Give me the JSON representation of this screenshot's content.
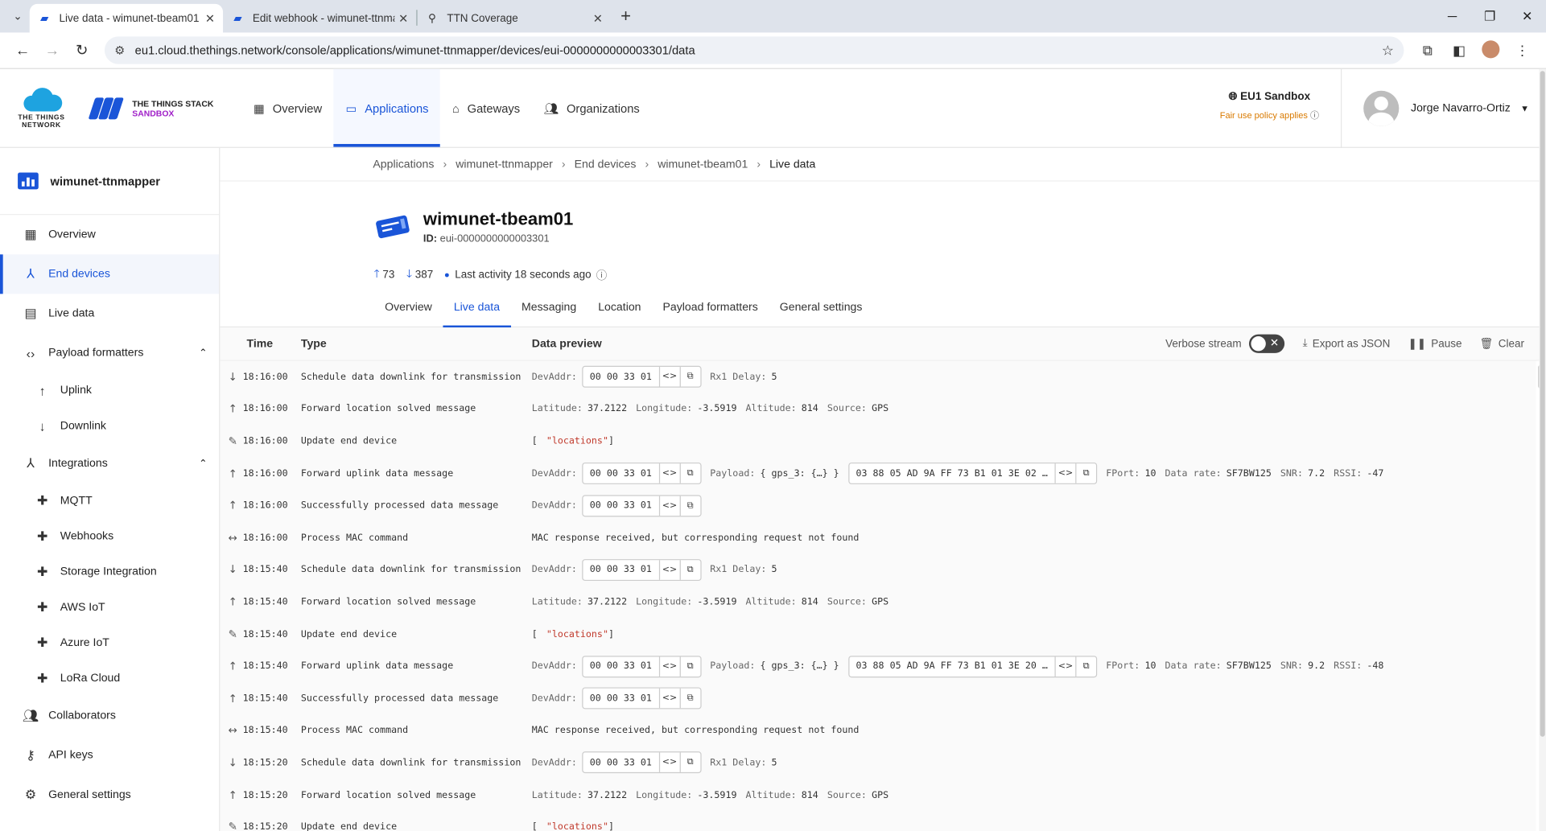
{
  "browser": {
    "tabs": [
      {
        "label": "Live data - wimunet-tbeam01 -",
        "active": true,
        "icon": "ttn-icon"
      },
      {
        "label": "Edit webhook - wimunet-ttnma",
        "active": false,
        "icon": "ttn-icon"
      },
      {
        "label": "TTN Coverage",
        "active": false,
        "icon": "map-pin-icon"
      }
    ],
    "url": "eu1.cloud.thethings.network/console/applications/wimunet-ttnmapper/devices/eui-0000000000003301/data"
  },
  "header": {
    "logo_text": "THE THINGS NETWORK",
    "stack_line1": "THE THINGS STACK",
    "stack_line2": "SANDBOX",
    "nav": [
      {
        "label": "Overview",
        "icon": "dashboard-icon",
        "active": false
      },
      {
        "label": "Applications",
        "icon": "application-icon",
        "active": true
      },
      {
        "label": "Gateways",
        "icon": "gateway-icon",
        "active": false
      },
      {
        "label": "Organizations",
        "icon": "organizations-icon",
        "active": false
      }
    ],
    "region": "EU1 Sandbox",
    "fair_use": "Fair use policy applies",
    "user": "Jorge Navarro-Ortiz"
  },
  "sidebar": {
    "app_name": "wimunet-ttnmapper",
    "items": [
      {
        "label": "Overview",
        "icon": "dashboard-icon"
      },
      {
        "label": "End devices",
        "icon": "devices-icon",
        "active": true
      },
      {
        "label": "Live data",
        "icon": "live-data-icon"
      },
      {
        "label": "Payload formatters",
        "icon": "code-icon"
      },
      {
        "label": "Uplink",
        "icon": "arrow-up-icon"
      },
      {
        "label": "Downlink",
        "icon": "arrow-down-icon"
      },
      {
        "label": "Integrations",
        "icon": "integrations-icon"
      },
      {
        "label": "MQTT",
        "icon": "puzzle-icon"
      },
      {
        "label": "Webhooks",
        "icon": "puzzle-icon"
      },
      {
        "label": "Storage Integration",
        "icon": "puzzle-icon"
      },
      {
        "label": "AWS IoT",
        "icon": "puzzle-icon"
      },
      {
        "label": "Azure IoT",
        "icon": "puzzle-icon"
      },
      {
        "label": "LoRa Cloud",
        "icon": "puzzle-icon"
      },
      {
        "label": "Collaborators",
        "icon": "people-icon"
      },
      {
        "label": "API keys",
        "icon": "key-icon"
      },
      {
        "label": "General settings",
        "icon": "gear-icon"
      }
    ]
  },
  "breadcrumb": [
    "Applications",
    "wimunet-ttnmapper",
    "End devices",
    "wimunet-tbeam01",
    "Live data"
  ],
  "device": {
    "name": "wimunet-tbeam01",
    "id_label": "ID:",
    "id": "eui-0000000000003301",
    "uplinks": "73",
    "downlinks": "387",
    "last_activity": "Last activity 18 seconds ago"
  },
  "device_tabs": [
    "Overview",
    "Live data",
    "Messaging",
    "Location",
    "Payload formatters",
    "General settings"
  ],
  "live": {
    "col_time": "Time",
    "col_type": "Type",
    "col_preview": "Data preview",
    "verbose": "Verbose stream",
    "export": "Export as JSON",
    "pause": "Pause",
    "clear": "Clear",
    "rows": [
      {
        "icon": "arrow-down-icon",
        "time": "18:16:00",
        "type": "Schedule data downlink for transmission",
        "kind": "downlink",
        "devaddr": "00 00 33 01",
        "rx1": "5"
      },
      {
        "icon": "arrow-up-icon",
        "time": "18:16:00",
        "type": "Forward location solved message",
        "kind": "location",
        "lat": "37.2122",
        "lon": "-3.5919",
        "alt": "814",
        "src": "GPS"
      },
      {
        "icon": "pencil-icon",
        "time": "18:16:00",
        "type": "Update end device",
        "kind": "update",
        "locations": "\"locations\""
      },
      {
        "icon": "arrow-up-icon",
        "time": "18:16:00",
        "type": "Forward uplink data message",
        "kind": "uplink",
        "devaddr": "00 00 33 01",
        "payload": "{ gps_3: {…} }",
        "bytes": "03 88 05 AD 9A FF 73 B1 01 3E 02 …",
        "fport": "10",
        "rate": "SF7BW125",
        "snr": "7.2",
        "rssi": "-47"
      },
      {
        "icon": "arrow-up-icon",
        "time": "18:16:00",
        "type": "Successfully processed data message",
        "kind": "processed",
        "devaddr": "00 00 33 01"
      },
      {
        "icon": "mac-icon",
        "time": "18:16:00",
        "type": "Process MAC command",
        "kind": "mac",
        "text": "MAC response received, but corresponding request not found"
      },
      {
        "icon": "arrow-down-icon",
        "time": "18:15:40",
        "type": "Schedule data downlink for transmission",
        "kind": "downlink",
        "devaddr": "00 00 33 01",
        "rx1": "5"
      },
      {
        "icon": "arrow-up-icon",
        "time": "18:15:40",
        "type": "Forward location solved message",
        "kind": "location",
        "lat": "37.2122",
        "lon": "-3.5919",
        "alt": "814",
        "src": "GPS"
      },
      {
        "icon": "pencil-icon",
        "time": "18:15:40",
        "type": "Update end device",
        "kind": "update",
        "locations": "\"locations\""
      },
      {
        "icon": "arrow-up-icon",
        "time": "18:15:40",
        "type": "Forward uplink data message",
        "kind": "uplink",
        "devaddr": "00 00 33 01",
        "payload": "{ gps_3: {…} }",
        "bytes": "03 88 05 AD 9A FF 73 B1 01 3E 20 …",
        "fport": "10",
        "rate": "SF7BW125",
        "snr": "9.2",
        "rssi": "-48"
      },
      {
        "icon": "arrow-up-icon",
        "time": "18:15:40",
        "type": "Successfully processed data message",
        "kind": "processed",
        "devaddr": "00 00 33 01"
      },
      {
        "icon": "mac-icon",
        "time": "18:15:40",
        "type": "Process MAC command",
        "kind": "mac",
        "text": "MAC response received, but corresponding request not found"
      },
      {
        "icon": "arrow-down-icon",
        "time": "18:15:20",
        "type": "Schedule data downlink for transmission",
        "kind": "downlink",
        "devaddr": "00 00 33 01",
        "rx1": "5"
      },
      {
        "icon": "arrow-up-icon",
        "time": "18:15:20",
        "type": "Forward location solved message",
        "kind": "location",
        "lat": "37.2122",
        "lon": "-3.5919",
        "alt": "814",
        "src": "GPS"
      },
      {
        "icon": "pencil-icon",
        "time": "18:15:20",
        "type": "Update end device",
        "kind": "update",
        "locations": "\"locations\""
      }
    ],
    "labels": {
      "devaddr": "DevAddr:",
      "rx1": "Rx1 Delay:",
      "lat": "Latitude:",
      "lon": "Longitude:",
      "alt": "Altitude:",
      "src": "Source:",
      "payload": "Payload:",
      "fport": "FPort:",
      "rate": "Data rate:",
      "snr": "SNR:",
      "rssi": "RSSI:"
    }
  },
  "colors": {
    "accent": "#1a55d8",
    "sandbox": "#a020c8",
    "warning": "#d97a00"
  }
}
